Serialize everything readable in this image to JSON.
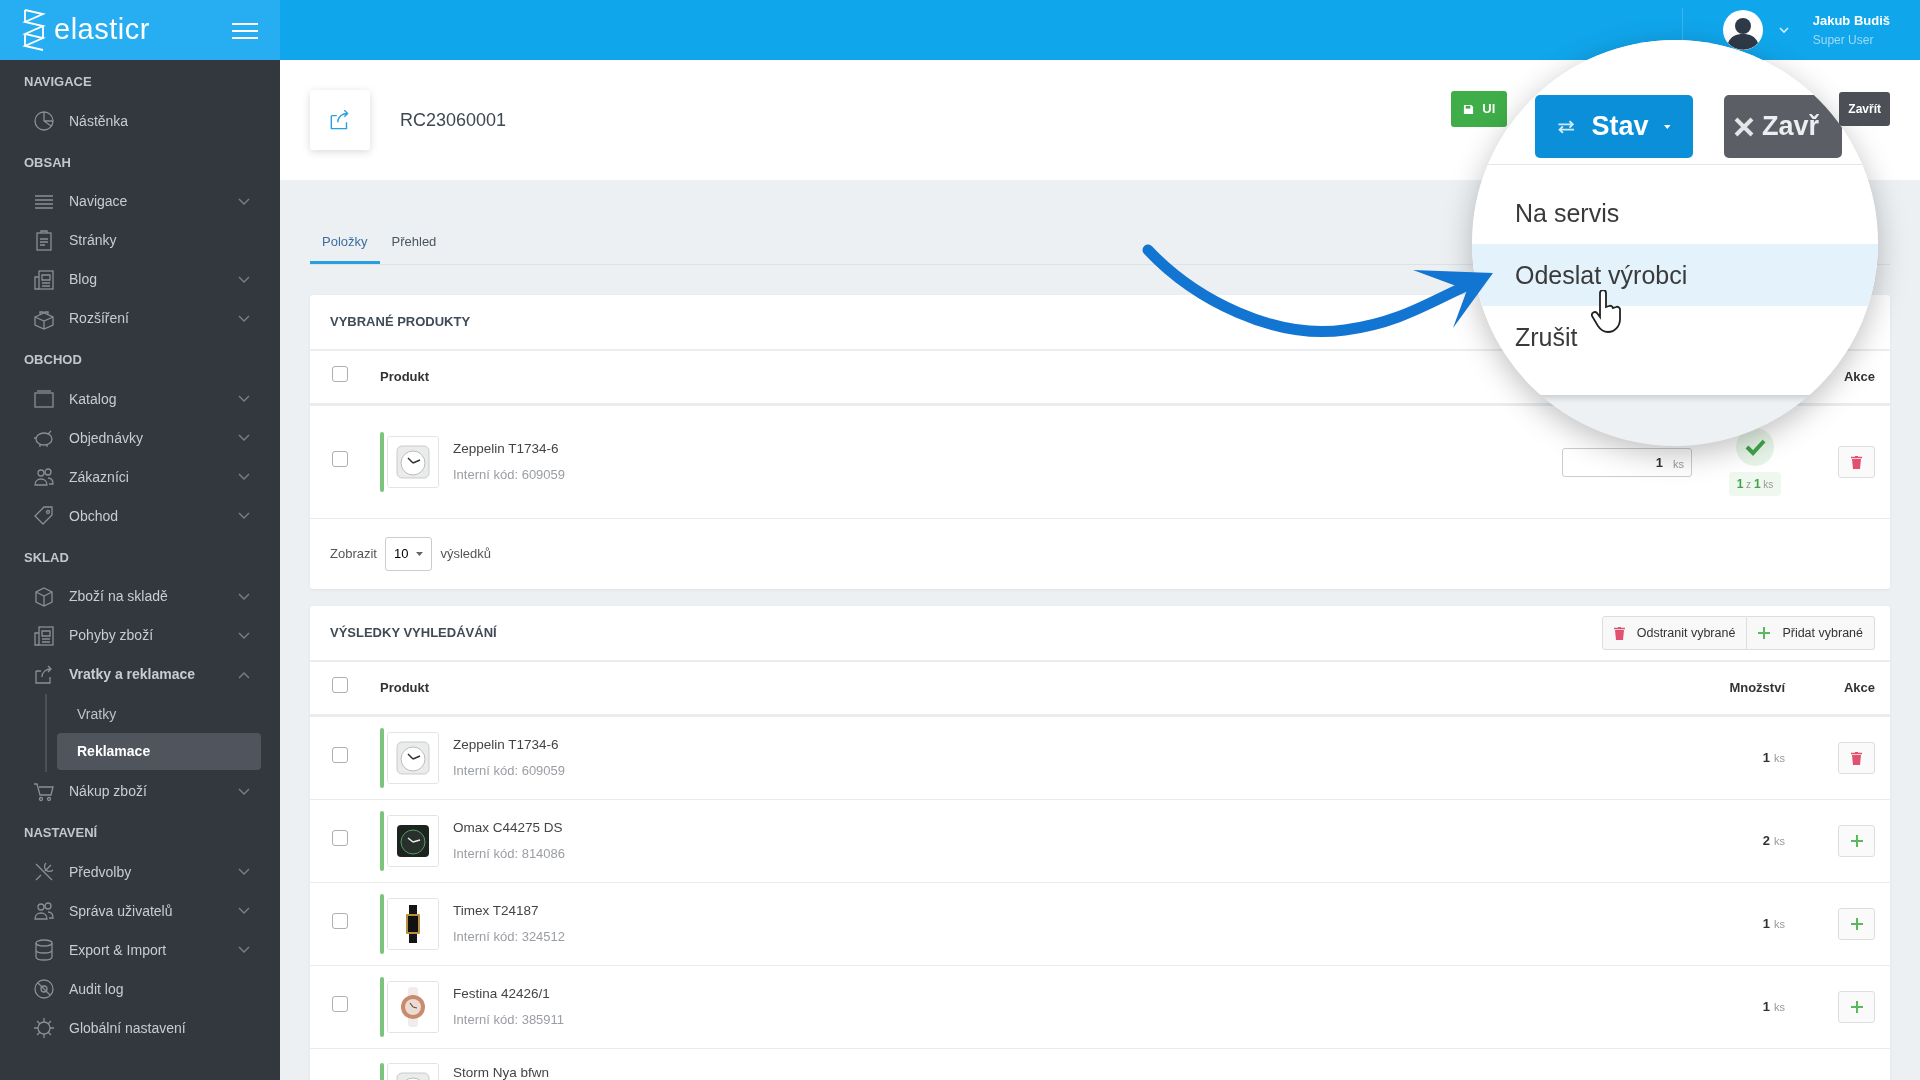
{
  "app": {
    "logo": "elasticr"
  },
  "user": {
    "name": "Jakub Budiš",
    "role": "Super User"
  },
  "sidebar": {
    "sections": [
      {
        "title": "NAVIGACE",
        "items": [
          {
            "label": "Nástěnka",
            "kind": "link"
          }
        ]
      },
      {
        "title": "OBSAH",
        "items": [
          {
            "label": "Navigace",
            "kind": "submenu",
            "expanded": false
          },
          {
            "label": "Stránky",
            "kind": "link"
          },
          {
            "label": "Blog",
            "kind": "submenu",
            "expanded": false
          },
          {
            "label": "Rozšíření",
            "kind": "submenu",
            "expanded": false
          }
        ]
      },
      {
        "title": "OBCHOD",
        "items": [
          {
            "label": "Katalog",
            "kind": "submenu",
            "expanded": false
          },
          {
            "label": "Objednávky",
            "kind": "submenu",
            "expanded": false
          },
          {
            "label": "Zákazníci",
            "kind": "submenu",
            "expanded": false
          },
          {
            "label": "Obchod",
            "kind": "submenu",
            "expanded": false
          }
        ]
      },
      {
        "title": "SKLAD",
        "items": [
          {
            "label": "Zboží na skladě",
            "kind": "submenu",
            "expanded": false
          },
          {
            "label": "Pohyby zboží",
            "kind": "submenu",
            "expanded": false
          },
          {
            "label": "Vratky a reklamace",
            "kind": "submenu",
            "expanded": true,
            "children": [
              {
                "label": "Vratky",
                "selected": false
              },
              {
                "label": "Reklamace",
                "selected": true
              }
            ]
          },
          {
            "label": "Nákup zboží",
            "kind": "submenu",
            "expanded": false
          }
        ]
      },
      {
        "title": "NASTAVENÍ",
        "items": [
          {
            "label": "Předvolby",
            "kind": "submenu",
            "expanded": false
          },
          {
            "label": "Správa uživatelů",
            "kind": "submenu",
            "expanded": false
          },
          {
            "label": "Export & Import",
            "kind": "submenu",
            "expanded": false
          },
          {
            "label": "Audit log",
            "kind": "link"
          },
          {
            "label": "Globální nastavení",
            "kind": "link"
          }
        ]
      }
    ]
  },
  "page": {
    "title": "RC23060001",
    "toolbar": [
      {
        "label": "Ul",
        "kind": "save"
      },
      {
        "label": "Zavřít",
        "kind": "close"
      }
    ]
  },
  "tabs": [
    {
      "label": "Položky",
      "selected": true
    },
    {
      "label": "Přehled",
      "selected": false
    }
  ],
  "magnifier": {
    "buttons": [
      {
        "label": "Stav",
        "kind": "status"
      },
      {
        "label": "Zavř",
        "kind": "close"
      }
    ],
    "menu": [
      {
        "label": "Na servis",
        "selected": false
      },
      {
        "label": "Odeslat výrobci",
        "selected": true
      },
      {
        "label": "Zrušit",
        "selected": false
      }
    ]
  },
  "selected_products": {
    "title": "VYBRANÉ PRODUKTY",
    "all_checked": false,
    "columns": [
      "Produkt",
      "Akce"
    ],
    "rows": [
      {
        "name": "Zeppelin T1734-6",
        "code": "Interní kód: 609059",
        "checked": false,
        "quantity": "1",
        "unit": "ks",
        "fulfilled": "**1** z **1** ks",
        "done": true
      }
    ],
    "footer": {
      "before": "Zobrazit",
      "page_size": "10",
      "after": "výsledků"
    }
  },
  "search_results": {
    "title": "VÝSLEDKY VYHLEDÁVÁNÍ",
    "all_checked": false,
    "actions": [
      {
        "label": "Odstranit vybrané",
        "kind": "remove"
      },
      {
        "label": "Přidat vybrané",
        "kind": "add"
      }
    ],
    "columns": [
      "Produkt",
      "Množství",
      "Akce"
    ],
    "rows": [
      {
        "name": "Zeppelin T1734-6",
        "code": "Interní kód: 609059",
        "checked": false,
        "quantity": "1",
        "unit": "ks",
        "kind": "remove"
      },
      {
        "name": "Omax C44275 DS",
        "code": "Interní kód: 814086",
        "checked": false,
        "quantity": "2",
        "unit": "ks",
        "kind": "add"
      },
      {
        "name": "Timex T24187",
        "code": "Interní kód: 324512",
        "checked": false,
        "quantity": "1",
        "unit": "ks",
        "kind": "add"
      },
      {
        "name": "Festina 42426/1",
        "code": "Interní kód: 385911",
        "checked": false,
        "quantity": "1",
        "unit": "ks",
        "kind": "add"
      },
      {
        "name": "Storm Nya bfwn",
        "kind": "partial"
      }
    ]
  }
}
